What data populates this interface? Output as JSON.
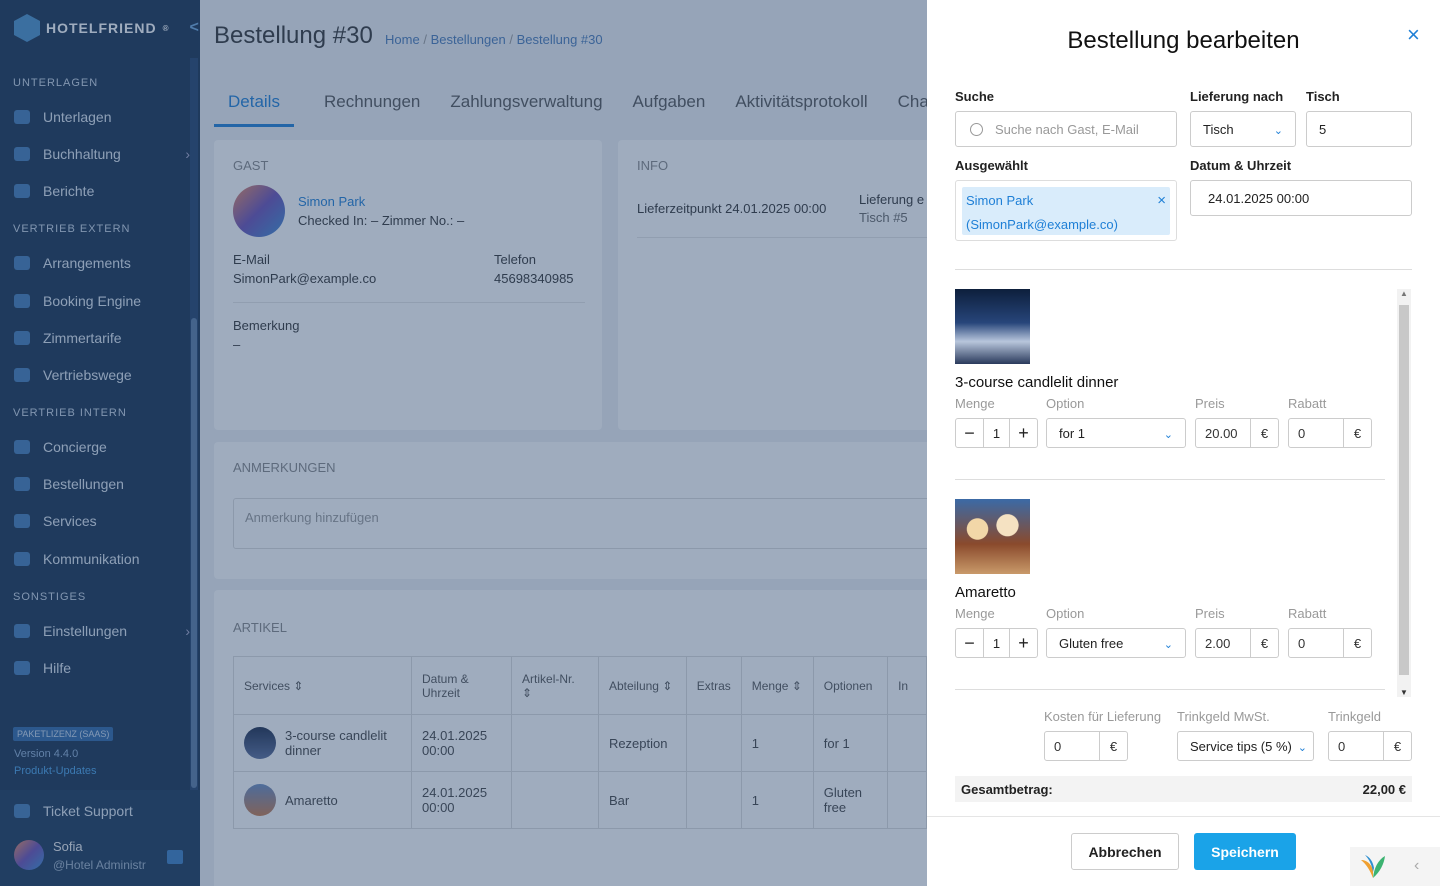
{
  "sidebar": {
    "brand": "HOTELFRIEND",
    "brand_mark": "®",
    "collapse_glyph": "<",
    "sections": [
      {
        "title": "UNTERLAGEN",
        "items": [
          {
            "label": "Unterlagen"
          },
          {
            "label": "Buchhaltung",
            "has_submenu": true
          },
          {
            "label": "Berichte"
          }
        ]
      },
      {
        "title": "VERTRIEB EXTERN",
        "items": [
          {
            "label": "Arrangements"
          },
          {
            "label": "Booking Engine"
          },
          {
            "label": "Zimmertarife"
          },
          {
            "label": "Vertriebswege"
          }
        ]
      },
      {
        "title": "VERTRIEB INTERN",
        "items": [
          {
            "label": "Concierge"
          },
          {
            "label": "Bestellungen"
          },
          {
            "label": "Services"
          },
          {
            "label": "Kommunikation"
          }
        ]
      },
      {
        "title": "SONSTIGES",
        "items": [
          {
            "label": "Einstellungen",
            "has_submenu": true
          },
          {
            "label": "Hilfe"
          }
        ]
      }
    ],
    "license": "PAKETLIZENZ (SAAS)",
    "version": "Version 4.4.0",
    "updates_link": "Produkt-Updates",
    "ticket_support": "Ticket Support",
    "user_name": "Sofia",
    "user_role": "@Hotel Administr"
  },
  "main": {
    "title": "Bestellung #30",
    "breadcrumb": [
      "Home",
      "/",
      "Bestellungen",
      "/",
      "Bestellung #30"
    ],
    "tabs": [
      "Details",
      "Rechnungen",
      "Zahlungsverwaltung",
      "Aufgaben",
      "Aktivitätsprotokoll",
      "Chat"
    ],
    "guest": {
      "heading": "GAST",
      "name": "Simon Park",
      "checked_in": "Checked In: – Zimmer No.: –",
      "email_label": "E-Mail",
      "email": "SimonPark@example.co",
      "phone_label": "Telefon",
      "phone": "45698340985",
      "remark_label": "Bemerkung",
      "remark": "–"
    },
    "info": {
      "heading": "INFO",
      "delivery_time": "Lieferzeitpunkt 24.01.2025 00:00",
      "delivery_label": "Lieferung e",
      "delivery_value": "Tisch #5"
    },
    "notes": {
      "heading": "ANMERKUNGEN",
      "placeholder": "Anmerkung hinzufügen"
    },
    "articles": {
      "heading": "ARTIKEL",
      "columns": [
        "Services",
        "Datum & Uhrzeit",
        "Artikel-Nr.",
        "Abteilung",
        "Extras",
        "Menge",
        "Optionen",
        "In"
      ],
      "rows": [
        {
          "service": "3-course candlelit dinner",
          "date": "24.01.2025 00:00",
          "article_no": "",
          "department": "Rezeption",
          "extras": "",
          "qty": "1",
          "options": "for 1"
        },
        {
          "service": "Amaretto",
          "date": "24.01.2025 00:00",
          "article_no": "",
          "department": "Bar",
          "extras": "",
          "qty": "1",
          "options": "Gluten free"
        }
      ]
    }
  },
  "panel": {
    "title": "Bestellung bearbeiten",
    "close_glyph": "×",
    "search_label": "Suche",
    "search_placeholder": "Suche nach Gast, E-Mail",
    "delivery_label": "Lieferung nach",
    "delivery_value": "Tisch",
    "table_label": "Tisch",
    "table_value": "5",
    "selected_label": "Ausgewählt",
    "selected_name": "Simon Park",
    "selected_email": "(SimonPark@example.co)",
    "datetime_label": "Datum & Uhrzeit",
    "datetime_value": "24.01.2025 00:00",
    "items": [
      {
        "name": "3-course candlelit dinner",
        "qty_label": "Menge",
        "option_label": "Option",
        "price_label": "Preis",
        "discount_label": "Rabatt",
        "qty": "1",
        "option": "for 1",
        "price": "20.00",
        "discount": "0",
        "currency": "€"
      },
      {
        "name": "Amaretto",
        "qty_label": "Menge",
        "option_label": "Option",
        "price_label": "Preis",
        "discount_label": "Rabatt",
        "qty": "1",
        "option": "Gluten free",
        "price": "2.00",
        "discount": "0",
        "currency": "€"
      }
    ],
    "delivery_cost_label": "Kosten für Lieferung",
    "delivery_cost": "0",
    "tip_vat_label": "Trinkgeld MwSt.",
    "tip_vat_value": "Service tips (5 %)",
    "tip_label": "Trinkgeld",
    "tip_value": "0",
    "currency": "€",
    "total_label": "Gesamtbetrag:",
    "total_value": "22,00 €",
    "cancel_button": "Abbrechen",
    "save_button": "Speichern"
  },
  "colors": {
    "accent": "#1e7fd6",
    "sidebar": "#16304f",
    "save": "#1aa3e8"
  }
}
